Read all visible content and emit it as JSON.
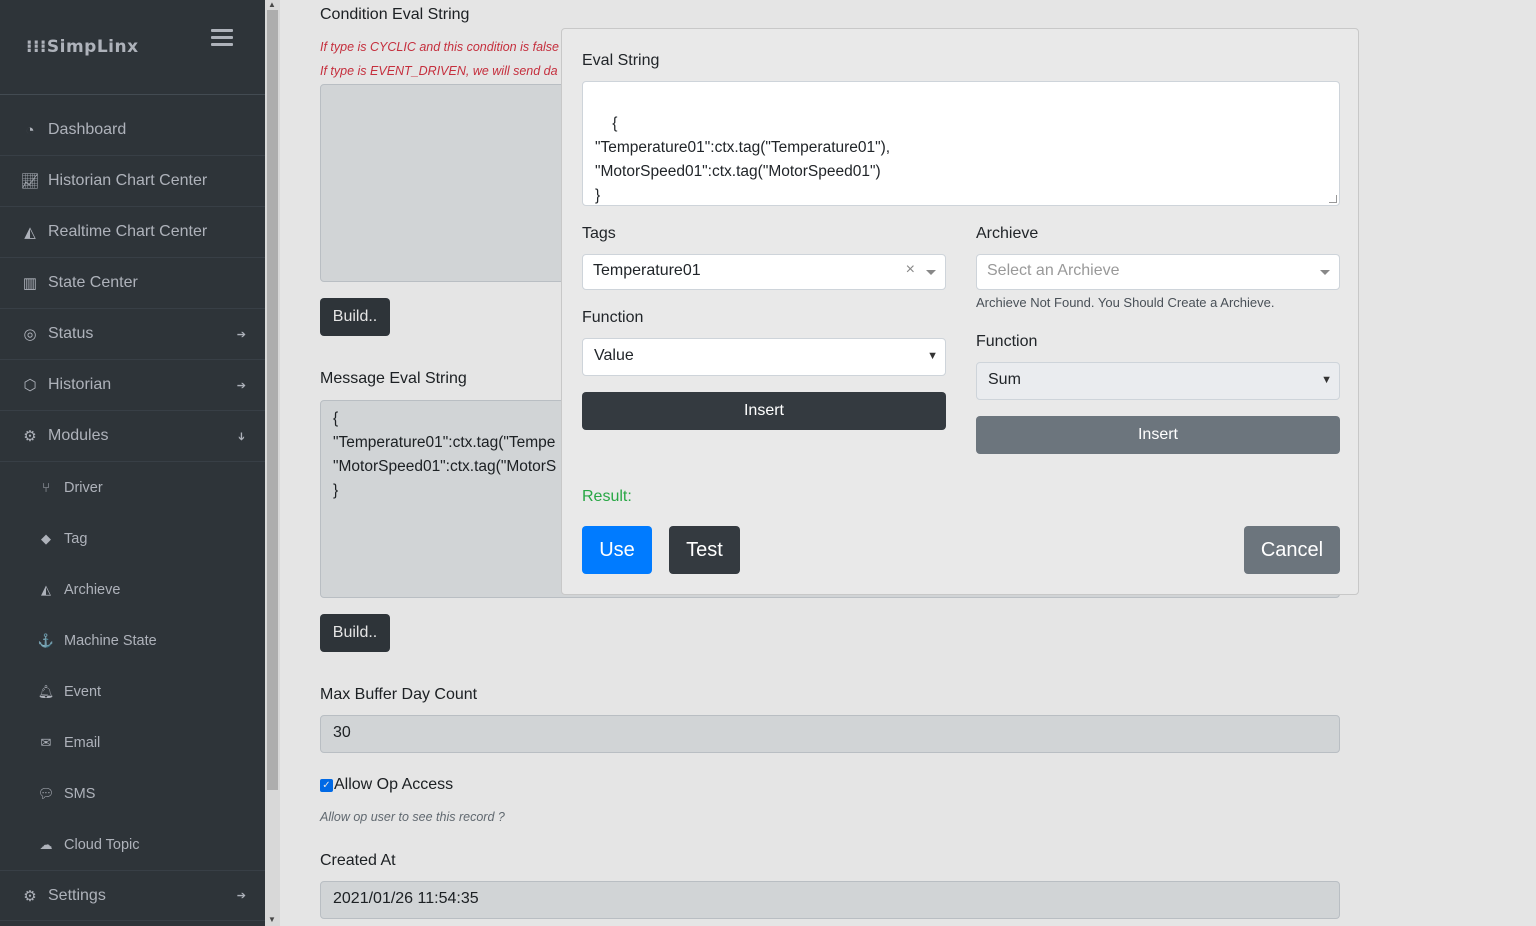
{
  "sidebar": {
    "brand": "⁝⁝⁝SimpLinx",
    "items": [
      {
        "label": "Dashboard",
        "icon": "tachometer-icon"
      },
      {
        "label": "Historian Chart Center",
        "icon": "line-chart-icon"
      },
      {
        "label": "Realtime Chart Center",
        "icon": "area-chart-icon"
      },
      {
        "label": "State Center",
        "icon": "bar-chart-icon"
      },
      {
        "label": "Status",
        "icon": "bullseye-icon"
      },
      {
        "label": "Historian",
        "icon": "hexagon-icon"
      },
      {
        "label": "Modules",
        "icon": "cogs-icon"
      }
    ],
    "subitems": [
      {
        "label": "Driver",
        "icon": "code-branch-icon"
      },
      {
        "label": "Tag",
        "icon": "tag-icon"
      },
      {
        "label": "Archieve",
        "icon": "area-chart-icon"
      },
      {
        "label": "Machine State",
        "icon": "anchor-icon"
      },
      {
        "label": "Event",
        "icon": "bell-icon"
      },
      {
        "label": "Email",
        "icon": "envelope-icon"
      },
      {
        "label": "SMS",
        "icon": "comment-icon"
      },
      {
        "label": "Cloud Topic",
        "icon": "cloud-icon"
      }
    ],
    "settings": {
      "label": "Settings",
      "icon": "gear-icon"
    }
  },
  "main": {
    "condition_label": "Condition Eval String",
    "condition_hint_1": "If type is CYCLIC and this condition is false",
    "condition_hint_2": "If type is EVENT_DRIVEN, we will send da",
    "build_label": "Build..",
    "message_label": "Message Eval String",
    "message_text": "{\n\"Temperature01\":ctx.tag(\"Tempe\n\"MotorSpeed01\":ctx.tag(\"MotorS\n}",
    "max_buffer_label": "Max Buffer Day Count",
    "max_buffer_value": "30",
    "allow_op_label": "Allow Op Access",
    "allow_op_hint": "Allow op user to see this record ?",
    "created_at_label": "Created At",
    "created_at_value": "2021/01/26 11:54:35"
  },
  "modal": {
    "eval_label": "Eval String",
    "eval_text": "{\n\"Temperature01\":ctx.tag(\"Temperature01\"),\n\"MotorSpeed01\":ctx.tag(\"MotorSpeed01\")\n}",
    "tags_label": "Tags",
    "tags_value": "Temperature01",
    "tags_clear": "×",
    "archieve_label": "Archieve",
    "archieve_placeholder": "Select an Archieve",
    "archieve_hint": "Archieve Not Found. You Should Create a Archieve.",
    "function_label": "Function",
    "function_left_value": "Value",
    "function_right_value": "Sum",
    "insert_label": "Insert",
    "result_label": "Result:",
    "use_label": "Use",
    "test_label": "Test",
    "cancel_label": "Cancel"
  },
  "colors": {
    "sidebar_bg": "#343a40",
    "primary": "#007bff",
    "dark": "#343a40",
    "secondary": "#6c757d",
    "success": "#28a745",
    "danger": "#dc3545"
  }
}
